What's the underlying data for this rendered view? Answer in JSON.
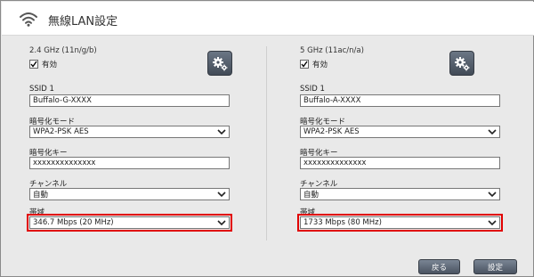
{
  "header": {
    "title": "無線LAN設定",
    "icon": "wifi-icon"
  },
  "bands": [
    {
      "title": "2.4 GHz (11n/g/b)",
      "enable_label": "有効",
      "enabled": true,
      "ssid_label": "SSID 1",
      "ssid_value": "Buffalo-G-XXXX",
      "encryption_label": "暗号化モード",
      "encryption_value": "WPA2-PSK AES",
      "key_label": "暗号化キー",
      "key_value": "xxxxxxxxxxxxxx",
      "channel_label": "チャンネル",
      "channel_value": "自動",
      "bandwidth_label": "帯域",
      "bandwidth_value": "346.7 Mbps (20 MHz)"
    },
    {
      "title": "5 GHz (11ac/n/a)",
      "enable_label": "有効",
      "enabled": true,
      "ssid_label": "SSID 1",
      "ssid_value": "Buffalo-A-XXXX",
      "encryption_label": "暗号化モード",
      "encryption_value": "WPA2-PSK AES",
      "key_label": "暗号化キー",
      "key_value": "xxxxxxxxxxxxxx",
      "channel_label": "チャンネル",
      "channel_value": "自動",
      "bandwidth_label": "帯域",
      "bandwidth_value": "1733 Mbps (80 MHz)"
    }
  ],
  "footer": {
    "back_label": "戻る",
    "set_label": "設定"
  },
  "colors": {
    "highlight": "#e10000",
    "button": "#4a5361"
  }
}
